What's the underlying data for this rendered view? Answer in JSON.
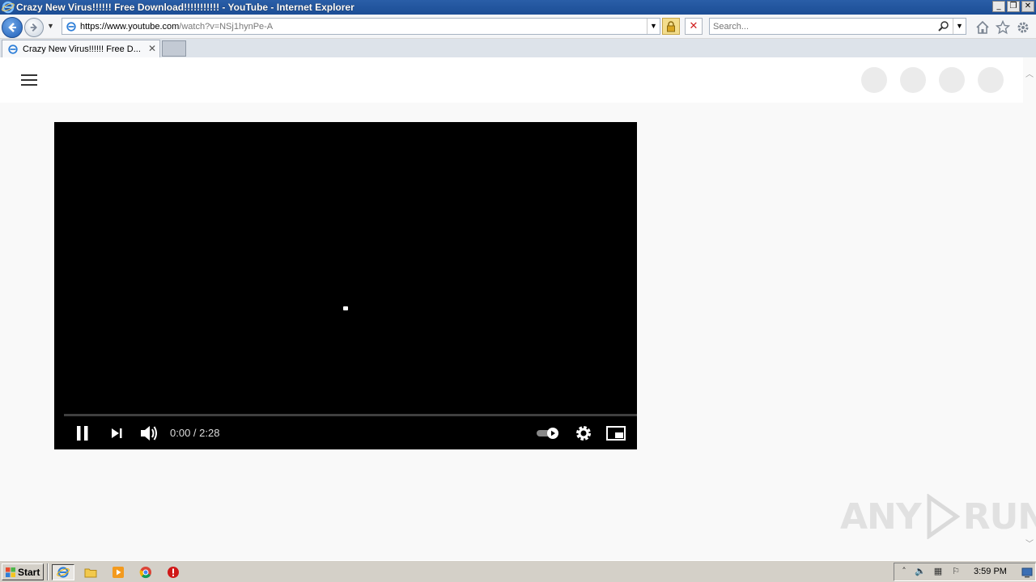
{
  "window": {
    "title": "Crazy New Virus!!!!!! Free Download!!!!!!!!!!! - YouTube - Internet Explorer",
    "minimize": "_",
    "maximize": "❐",
    "close": "✕"
  },
  "navbar": {
    "address_host": "https://www.youtube.com",
    "address_path": "/watch?v=NSj1hynPe-A",
    "search_placeholder": "Search..."
  },
  "tabs": [
    {
      "label": "Crazy New Virus!!!!!! Free D...",
      "active": true
    }
  ],
  "player": {
    "time": "0:00 / 2:28",
    "progress": 0,
    "state": "playing"
  },
  "watermark": {
    "left": "ANY",
    "right": "RUN"
  },
  "taskbar": {
    "start_label": "Start",
    "clock": "3:59 PM"
  },
  "colors": {
    "titlebar": "#2a5ea8",
    "progress_fill": "#ff0000",
    "player_bg": "#000000"
  }
}
